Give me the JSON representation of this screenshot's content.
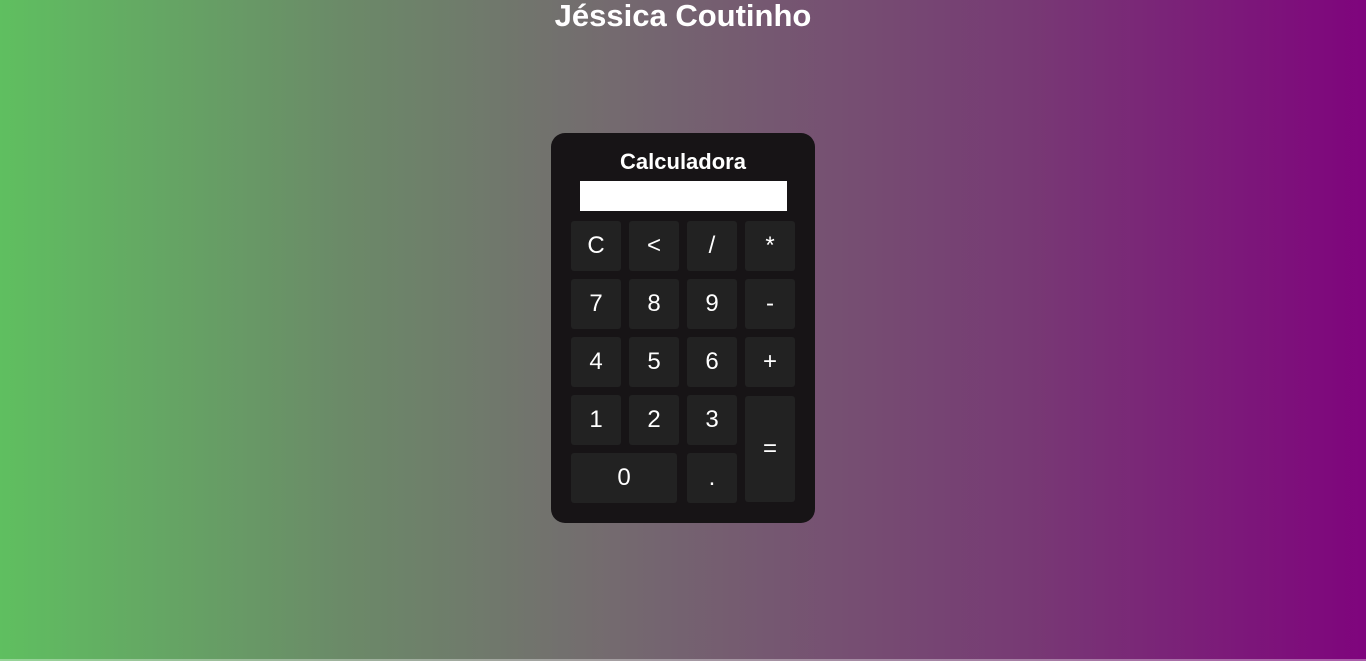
{
  "page": {
    "title": "Jéssica Coutinho"
  },
  "calculator": {
    "title": "Calculadora",
    "display_value": "",
    "keys": {
      "clear": "C",
      "backspace": "<",
      "divide": "/",
      "multiply": "*",
      "seven": "7",
      "eight": "8",
      "nine": "9",
      "minus": "-",
      "four": "4",
      "five": "5",
      "six": "6",
      "plus": "+",
      "one": "1",
      "two": "2",
      "three": "3",
      "equals": "=",
      "zero": "0",
      "decimal": "."
    }
  },
  "colors": {
    "gradient_start": "#5fbf60",
    "gradient_end": "#7f047d",
    "calculator_bg": "#171416",
    "key_bg": "#222222",
    "text": "#ffffff"
  }
}
